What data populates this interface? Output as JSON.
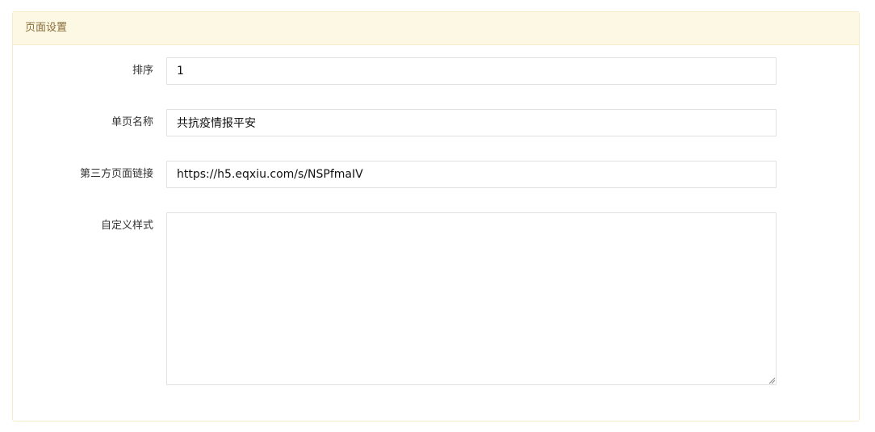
{
  "panel": {
    "title": "页面设置"
  },
  "fields": {
    "sort": {
      "label": "排序",
      "value": "1"
    },
    "page_name": {
      "label": "单页名称",
      "value": "共抗疫情报平安"
    },
    "third_party_link": {
      "label": "第三方页面链接",
      "value": "https://h5.eqxiu.com/s/NSPfmaIV"
    },
    "custom_style": {
      "label": "自定义样式",
      "value": ""
    }
  },
  "colors": {
    "heading_bg": "#fcf8e3",
    "heading_text": "#8a6d3b",
    "panel_border": "#f5ecc9",
    "input_border": "#e1e1e1"
  }
}
